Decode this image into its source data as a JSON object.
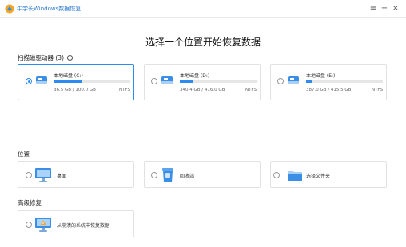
{
  "window": {
    "title": "牛学长Windows数据恢复",
    "controls": {
      "menu": "≡",
      "minimize": "−",
      "close": "×"
    }
  },
  "main_title": "选择一个位置开始恢复数据",
  "sections": {
    "drives_label": "扫描磁驱动器 (3)",
    "locations_label": "位置",
    "advanced_label": "高级修复"
  },
  "drives": [
    {
      "name": "本地磁盘 (C:)",
      "size": "36.5 GB / 100.0 GB",
      "fs": "NTFS",
      "used_fraction": 0.365,
      "selected": true
    },
    {
      "name": "本地磁盘 (D:)",
      "size": "340.4 GB / 416.0 GB",
      "fs": "NTFS",
      "used_fraction": 0.18,
      "selected": false
    },
    {
      "name": "本地磁盘 (E:)",
      "size": "387.0 GB / 415.5 GB",
      "fs": "NTFS",
      "used_fraction": 0.07,
      "selected": false
    }
  ],
  "locations": [
    {
      "label": "桌面",
      "icon": "monitor-icon"
    },
    {
      "label": "回收站",
      "icon": "recycle-bin-icon"
    },
    {
      "label": "选择文件夹",
      "icon": "folder-icon"
    }
  ],
  "advanced": [
    {
      "label": "从崩溃的系统中恢复数据",
      "icon": "crashed-system-icon"
    }
  ],
  "colors": {
    "accent": "#2d8cf0",
    "title_blue": "#2a7ad1"
  }
}
